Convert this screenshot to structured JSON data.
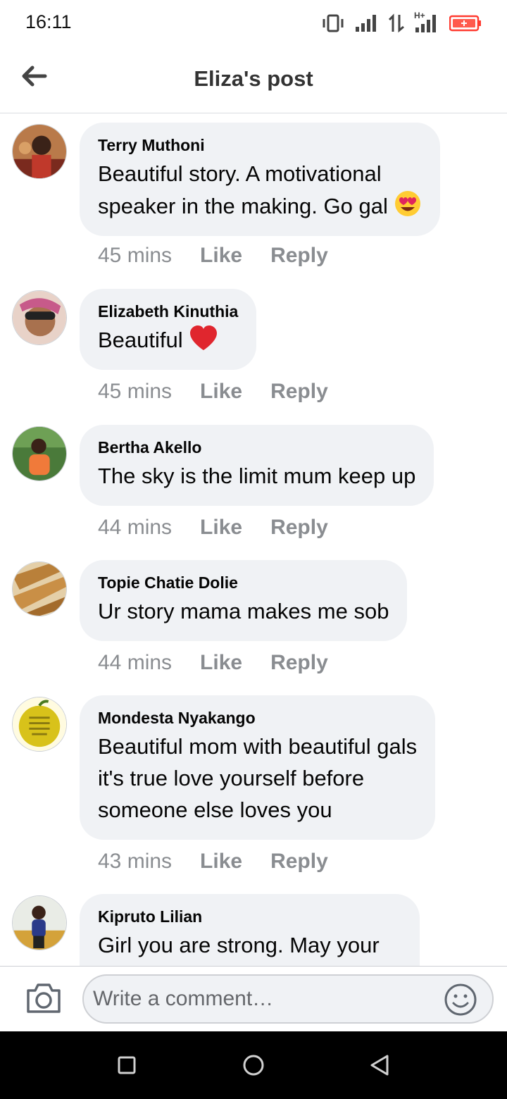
{
  "status_bar": {
    "time": "16:11",
    "network": "H+",
    "icons": [
      "vibrate-icon",
      "signal-icon",
      "data-arrows-icon",
      "signal-icon",
      "battery-icon"
    ],
    "battery_color": "#ff3b30"
  },
  "header": {
    "title": "Eliza's post",
    "back_icon": "arrow-left-icon"
  },
  "comments": [
    {
      "author": "Terry Muthoni",
      "lines": [
        "Beautiful story. A motivational",
        "speaker in the making. Go gal"
      ],
      "emoji": "heart-eyes-emoji",
      "time": "45 mins",
      "like": "Like",
      "reply": "Reply"
    },
    {
      "author": "Elizabeth Kinuthia",
      "lines": [
        "Beautiful"
      ],
      "emoji": "red-heart-emoji",
      "time": "45 mins",
      "like": "Like",
      "reply": "Reply"
    },
    {
      "author": "Bertha Akello",
      "lines": [
        "The sky is the limit mum keep up"
      ],
      "time": "44 mins",
      "like": "Like",
      "reply": "Reply"
    },
    {
      "author": "Topie Chatie Dolie",
      "lines": [
        "Ur story mama makes me sob"
      ],
      "time": "44 mins",
      "like": "Like",
      "reply": "Reply"
    },
    {
      "author": "Mondesta Nyakango",
      "lines": [
        "Beautiful mom with beautiful gals",
        "it's true love yourself before",
        "someone else loves you"
      ],
      "time": "43 mins",
      "like": "Like",
      "reply": "Reply"
    },
    {
      "author": "Kipruto Lilian",
      "lines": [
        "Girl you are strong. May your"
      ]
    }
  ],
  "composer": {
    "placeholder": "Write a comment…",
    "camera_icon": "camera-icon",
    "emoji_icon": "smile-icon"
  },
  "nav_bar": {
    "buttons": [
      "square-recents-icon",
      "circle-home-icon",
      "triangle-back-icon"
    ]
  },
  "colors": {
    "bubble": "#f0f2f5",
    "meta_text": "#8a8d91",
    "author_text": "#050505"
  }
}
